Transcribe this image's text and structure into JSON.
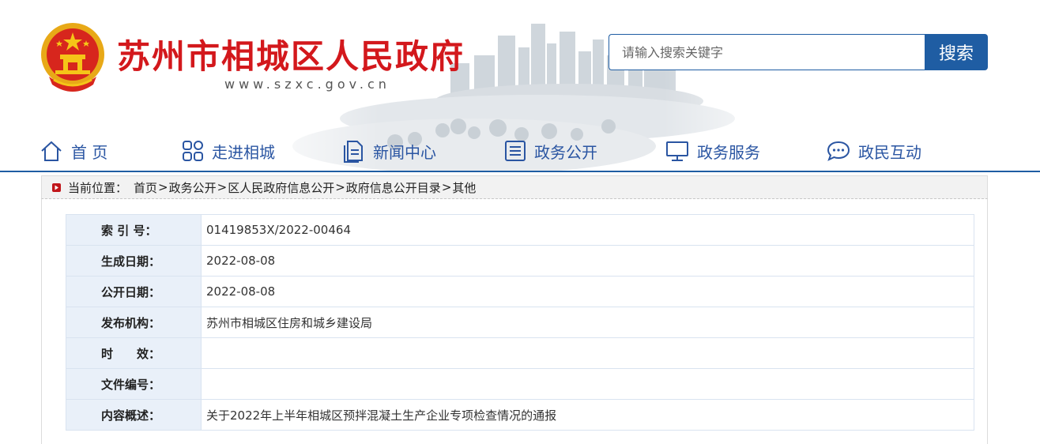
{
  "header": {
    "site_title": "苏州市相城区人民政府",
    "site_url": "www.szxc.gov.cn",
    "emblem": "national-emblem",
    "colors": {
      "title_red": "#d3181c",
      "brand_blue": "#1f5da3",
      "nav_text": "#2a55a2"
    }
  },
  "search": {
    "placeholder": "请输入搜索关键字",
    "button_label": "搜索"
  },
  "nav": {
    "items": [
      {
        "label": "首 页",
        "icon": "home-icon"
      },
      {
        "label": "走进相城",
        "icon": "grid-icon"
      },
      {
        "label": "新闻中心",
        "icon": "document-icon"
      },
      {
        "label": "政务公开",
        "icon": "list-icon"
      },
      {
        "label": "政务服务",
        "icon": "monitor-icon"
      },
      {
        "label": "政民互动",
        "icon": "chat-icon"
      }
    ]
  },
  "breadcrumb": {
    "label": "当前位置：",
    "items": [
      "首页",
      "政务公开",
      "区人民政府信息公开",
      "政府信息公开目录",
      "其他"
    ],
    "separator": ">"
  },
  "info": {
    "rows": [
      {
        "key": "索 引 号：",
        "value": "01419853X/2022-00464"
      },
      {
        "key": "生成日期：",
        "value": "2022-08-08"
      },
      {
        "key": "公开日期：",
        "value": "2022-08-08"
      },
      {
        "key": "发布机构：",
        "value": "苏州市相城区住房和城乡建设局"
      },
      {
        "key": "时　　效：",
        "value": ""
      },
      {
        "key": "文件编号：",
        "value": ""
      },
      {
        "key": "内容概述：",
        "value": "关于2022年上半年相城区预拌混凝土生产企业专项检查情况的通报"
      }
    ]
  }
}
